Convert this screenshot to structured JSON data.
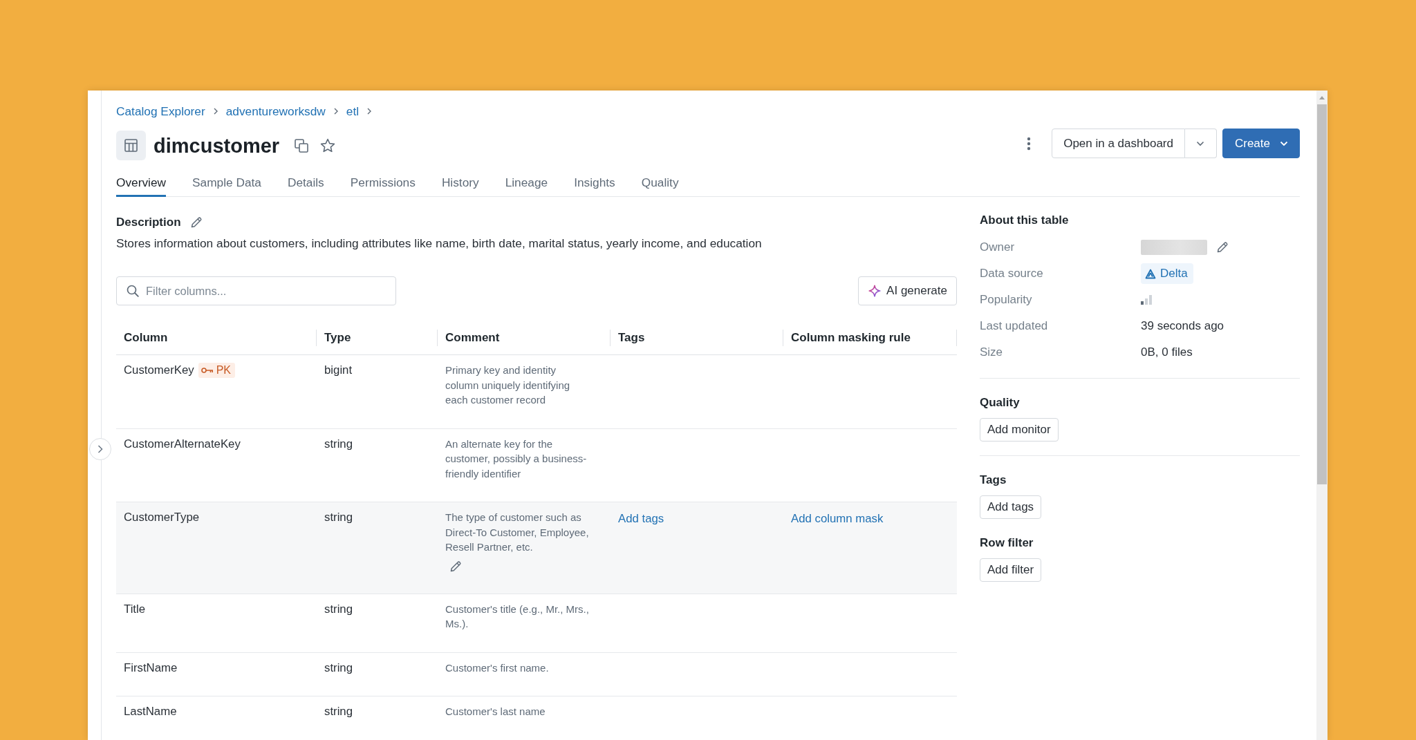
{
  "breadcrumb": [
    {
      "label": "Catalog Explorer"
    },
    {
      "label": "adventureworksdw"
    },
    {
      "label": "etl"
    }
  ],
  "header": {
    "title": "dimcustomer",
    "starred": false,
    "open_button": "Open in a dashboard",
    "create_button": "Create"
  },
  "tabs": [
    {
      "label": "Overview",
      "selected": true
    },
    {
      "label": "Sample Data",
      "selected": false
    },
    {
      "label": "Details",
      "selected": false
    },
    {
      "label": "Permissions",
      "selected": false
    },
    {
      "label": "History",
      "selected": false
    },
    {
      "label": "Lineage",
      "selected": false
    },
    {
      "label": "Insights",
      "selected": false
    },
    {
      "label": "Quality",
      "selected": false
    }
  ],
  "description": {
    "label": "Description",
    "text": "Stores information about customers, including attributes like name, birth date, marital status, yearly income, and education"
  },
  "filter": {
    "placeholder": "Filter columns..."
  },
  "ai_button": "AI generate",
  "table": {
    "columns": [
      "Column",
      "Type",
      "Comment",
      "Tags",
      "Column masking rule"
    ],
    "rows": [
      {
        "name": "CustomerKey",
        "badge": "PK",
        "type": "bigint",
        "comment": "Primary key and identity column uniquely identifying each customer record",
        "hovered": false
      },
      {
        "name": "CustomerAlternateKey",
        "type": "string",
        "comment": "An alternate key for the customer, possibly a business-friendly identifier",
        "hovered": false
      },
      {
        "name": "CustomerType",
        "type": "string",
        "comment": "The type of customer such as Direct-To Customer, Employee, Resell Partner, etc.",
        "hovered": true,
        "tags_link": "Add tags",
        "mask_link": "Add column mask"
      },
      {
        "name": "Title",
        "type": "string",
        "comment": "Customer's title (e.g., Mr., Mrs., Ms.).",
        "hovered": false
      },
      {
        "name": "FirstName",
        "type": "string",
        "comment": "Customer's first name.",
        "hovered": false
      },
      {
        "name": "LastName",
        "type": "string",
        "comment": "Customer's last name",
        "hovered": false
      }
    ]
  },
  "about": {
    "title": "About this table",
    "fields": [
      {
        "label": "Owner",
        "kind": "redacted",
        "editable": true
      },
      {
        "label": "Data source",
        "kind": "source",
        "value": "Delta",
        "editable": false
      },
      {
        "label": "Popularity",
        "kind": "popularity",
        "editable": false
      },
      {
        "label": "Last updated",
        "kind": "text",
        "value": "39 seconds ago",
        "editable": false
      },
      {
        "label": "Size",
        "kind": "text",
        "value": "0B, 0 files",
        "editable": false
      }
    ]
  },
  "sections": [
    {
      "title": "Quality",
      "button": "Add monitor",
      "divided": true
    },
    {
      "title": "Tags",
      "button": "Add tags",
      "divided": false
    },
    {
      "title": "Row filter",
      "button": "Add filter",
      "divided": false
    }
  ]
}
